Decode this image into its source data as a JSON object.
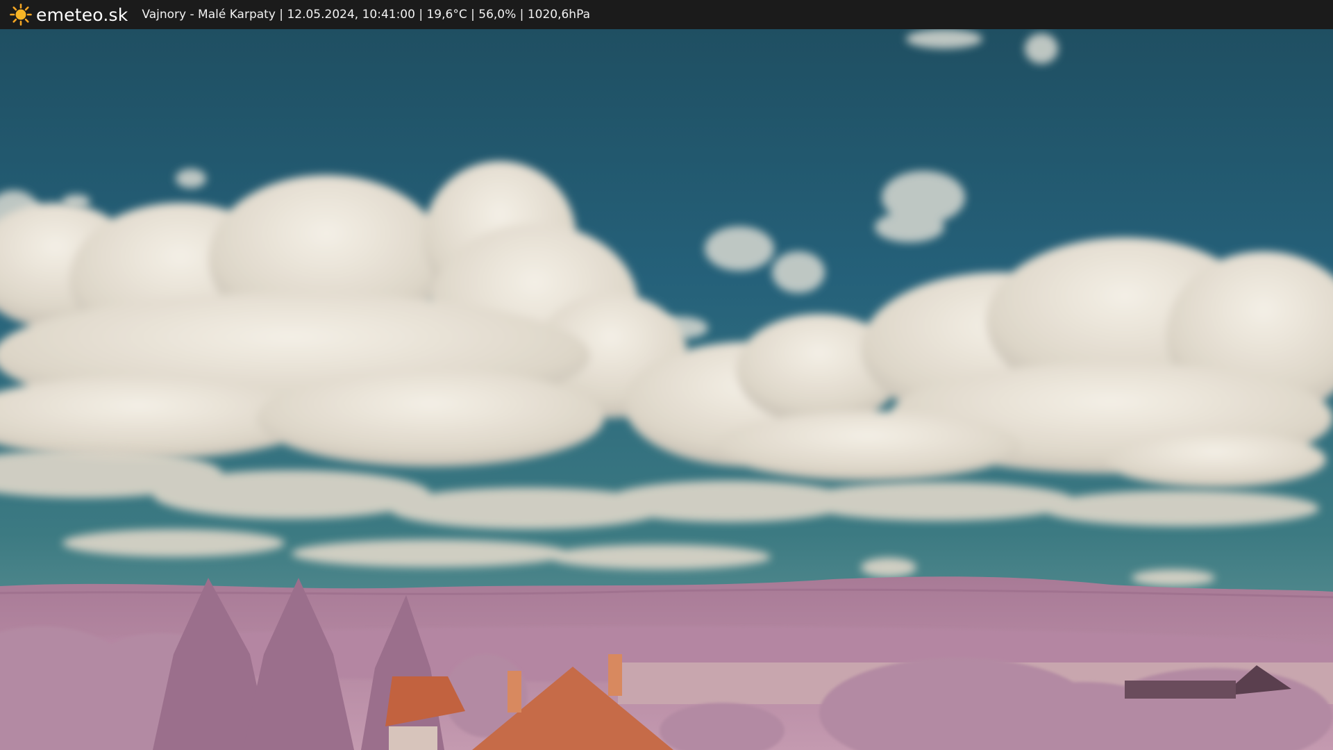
{
  "header": {
    "brand": "emeteo.sk",
    "location": "Vajnory - Malé Karpaty",
    "datetime": "12.05.2024, 10:41:00",
    "temperature": "19,6°C",
    "humidity": "56,0%",
    "pressure": "1020,6hPa",
    "separator": " | ",
    "logo_icon": "sun-icon"
  },
  "colors": {
    "topbar": "#1b1b1b",
    "sky": "#23596d",
    "clouds": "#e8e1d4",
    "vegetation": "#b88aa4",
    "roof": "#c2623f"
  }
}
